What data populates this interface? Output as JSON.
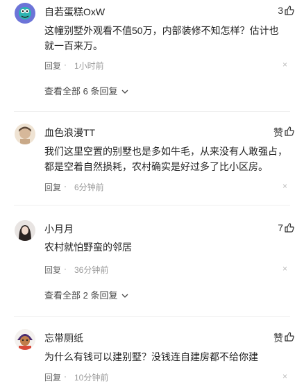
{
  "comments": [
    {
      "username": "自若蛋糕OxW",
      "likes": "3",
      "text": "这幢别墅外观看不值50万，内部装修不知怎样？估计也就一百来万。",
      "reply_label": "回复",
      "dot": "·",
      "time": "1小时前",
      "close": "×",
      "more_replies": "查看全部 6 条回复"
    },
    {
      "username": "血色浪漫TT",
      "likes": "赞",
      "text": "我们这里空置的别墅也是多如牛毛，从来没有人敢强占，都是空着自然损耗，农村确实是好过多了比小区房。",
      "reply_label": "回复",
      "dot": "·",
      "time": "6分钟前",
      "close": "×"
    },
    {
      "username": "小月月",
      "likes": "7",
      "text": "农村就怕野蛮的邻居",
      "reply_label": "回复",
      "dot": "·",
      "time": "36分钟前",
      "close": "×",
      "more_replies": "查看全部 2 条回复"
    },
    {
      "username": "忘带厕纸",
      "likes": "赞",
      "text": "为什么有钱可以建别墅？没钱连自建房都不给你建",
      "reply_label": "回复",
      "dot": "·",
      "time": "10分钟前",
      "close": "×"
    }
  ],
  "colors": {
    "text": "#222222",
    "meta": "#999999",
    "avatar1": "#6c74d8",
    "avatar2": "#d6c1aa"
  }
}
